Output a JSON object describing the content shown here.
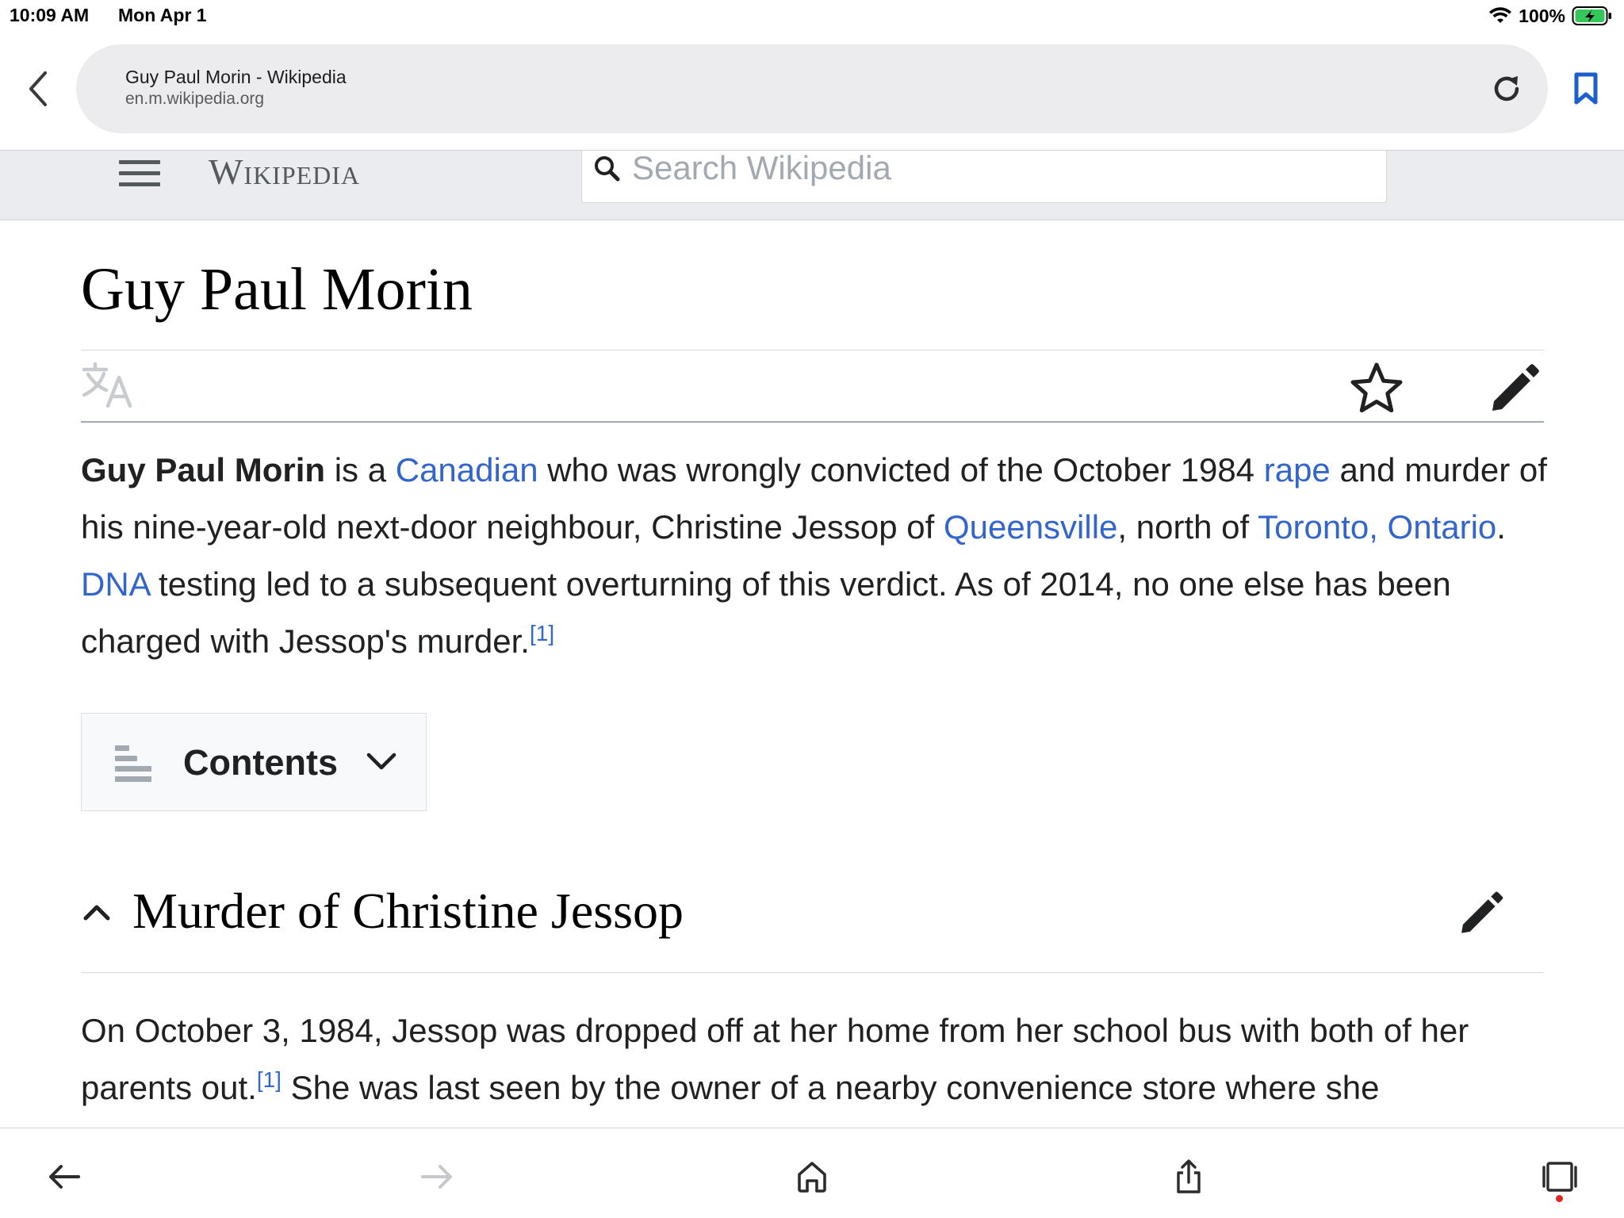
{
  "status_bar": {
    "time": "10:09 AM",
    "date": "Mon Apr 1",
    "battery_percent": "100%",
    "battery_level": 1.0,
    "charging": true
  },
  "browser": {
    "page_title": "Guy Paul Morin - Wikipedia",
    "host": "en.m.wikipedia.org",
    "accent_color": "#1a5fcc"
  },
  "wiki_header": {
    "wordmark": "Wikipedia",
    "search_placeholder": "Search Wikipedia"
  },
  "article": {
    "title": "Guy Paul Morin",
    "lead": {
      "subject": "Guy Paul Morin",
      "t1": " is a ",
      "link_canadian": "Canadian",
      "t2": " who was wrongly convicted of the October 1984 ",
      "link_rape": "rape",
      "t3": " and murder of his nine-year-old next-door neighbour, Christine Jessop of ",
      "link_queensville": "Queensville",
      "t4": ", north of ",
      "link_toronto": "Toronto, Ontario",
      "t5": ". ",
      "link_dna": "DNA",
      "t6": " testing led to a subsequent overturning of this verdict. As of 2014, no one else has been charged with Jessop's murder.",
      "ref": "[1]"
    },
    "contents_label": "Contents",
    "section": {
      "heading": "Murder of Christine Jessop",
      "t1": "On October 3, 1984, Jessop was dropped off at her home from her school bus with both of her parents out.",
      "ref": "[1]",
      "t2": " She was last seen by the owner of a nearby convenience store where she"
    }
  },
  "colors": {
    "link": "#3366cc",
    "header_bg": "#eaecf0",
    "text": "#202122"
  },
  "icons": {
    "back": "chevron-left-icon",
    "reload": "reload-icon",
    "bookmark": "bookmark-icon",
    "menu": "hamburger-icon",
    "search": "search-icon",
    "language": "translate-icon",
    "watch": "star-icon",
    "edit": "pencil-icon",
    "toc": "list-icon",
    "collapse": "chevron-up-icon",
    "toolbar": [
      "arrow-left-icon",
      "arrow-right-icon",
      "home-icon",
      "share-icon",
      "tabs-icon"
    ]
  }
}
